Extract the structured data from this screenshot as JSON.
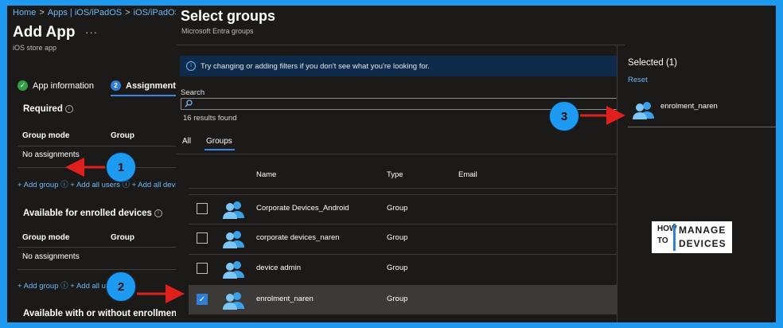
{
  "breadcrumb": [
    "Home",
    "Apps | iOS/iPadOS",
    "iOS/iPadOS"
  ],
  "page": {
    "title": "Add App",
    "more": "···",
    "subtitle": "iOS store app"
  },
  "wizard": {
    "step1": "App information",
    "step2_num": "2",
    "step2": "Assignments"
  },
  "required": {
    "title": "Required",
    "col_mode": "Group mode",
    "col_group": "Group",
    "empty": "No assignments",
    "links": "+ Add group ⓘ + Add all users ⓘ + Add all devices"
  },
  "enrolled": {
    "title": "Available for enrolled devices",
    "col_mode": "Group mode",
    "col_group": "Group",
    "empty": "No assignments",
    "links": "+ Add group ⓘ + Add all users ⓘ"
  },
  "without": {
    "title": "Available with or without enrollment"
  },
  "dialog": {
    "title": "Select groups",
    "subtitle": "Microsoft Entra groups",
    "banner": "Try changing or adding filters if you don't see what you're looking for.",
    "search_label": "Search",
    "search_value": "",
    "results": "16 results found",
    "tab_all": "All",
    "tab_groups": "Groups",
    "col_name": "Name",
    "col_type": "Type",
    "col_email": "Email",
    "rows": [
      {
        "name": "Corporate Devices_Android",
        "type": "Group",
        "checked": false
      },
      {
        "name": "corporate devices_naren",
        "type": "Group",
        "checked": false
      },
      {
        "name": "device admin",
        "type": "Group",
        "checked": false
      },
      {
        "name": "enrolment_naren",
        "type": "Group",
        "checked": true
      }
    ]
  },
  "selected": {
    "title": "Selected (1)",
    "reset": "Reset",
    "item": "enrolment_naren"
  },
  "logo": {
    "how": "HOW",
    "to": "TO",
    "manage": "MANAGE",
    "devices": "DEVICES"
  },
  "callouts": [
    "1",
    "2",
    "3"
  ],
  "colors": {
    "accent": "#1e9bf0",
    "link": "#6cb8f6",
    "arrow": "#e0201c",
    "check": "#2ea043"
  }
}
